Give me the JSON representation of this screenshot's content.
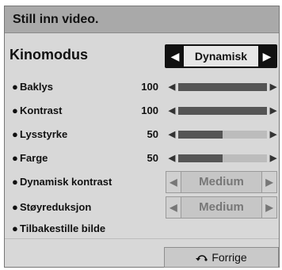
{
  "window": {
    "title": "Still inn video."
  },
  "mode": {
    "label": "Kinomodus",
    "value": "Dynamisk",
    "left_arrow": "◀",
    "right_arrow": "▶"
  },
  "sliders": [
    {
      "label": "Baklys",
      "value": "100",
      "fraction": 1.0
    },
    {
      "label": "Kontrast",
      "value": "100",
      "fraction": 1.0
    },
    {
      "label": "Lysstyrke",
      "value": "50",
      "fraction": 0.5
    },
    {
      "label": "Farge",
      "value": "50",
      "fraction": 0.5
    }
  ],
  "selects": [
    {
      "label": "Dynamisk kontrast",
      "value": "Medium"
    },
    {
      "label": "Støyreduksjon",
      "value": "Medium"
    }
  ],
  "reset": {
    "label": "Tilbakestille bilde"
  },
  "footer": {
    "back_label": "Forrige",
    "back_icon": "return-arrow-icon"
  },
  "glyphs": {
    "bullet": "●",
    "arrow_left": "◀",
    "arrow_right": "▶"
  },
  "colors": {
    "title_bar": "#a9a9a9",
    "panel": "#d8d8d8",
    "slider_fill": "#555555",
    "slider_track": "#bcbcbc"
  }
}
